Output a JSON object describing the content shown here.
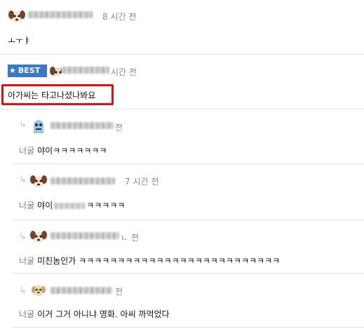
{
  "comments": [
    {
      "time": "8 시간 전",
      "text": "ㅗㅜㅑ"
    },
    {
      "badge": "BEST",
      "time": "시간 전",
      "text": "아가씨는 타고나셨나봐요"
    }
  ],
  "replies": [
    {
      "prefix": "너굴",
      "time": "전",
      "text": "야이ㅋㅋㅋㅋㅋㅋㅋ"
    },
    {
      "prefix": "너굴",
      "time": "7 시간 전",
      "text_start": "야이",
      "text_end": "ㅋㅋㅋㅋㅋ"
    },
    {
      "prefix": "너굴",
      "time": "ㄴ 전",
      "text": "미친놈인가 ㅋㅋㅋㅋㅋㅋㅋㅋㅋㅋㅋㅋㅋㅋㅋㅋㅋㅋㅋㅋㅋㅋㅋㅋㅋㅋ"
    },
    {
      "prefix": "너굴",
      "time": "전",
      "text": "이거 그거 아니냐 영화. 아씨 까먹었다"
    }
  ],
  "icons": {
    "reply": "reply-arrow-icon",
    "star": "star-icon"
  },
  "colors": {
    "best_badge": "#3a78c8",
    "highlight_border": "#e01010"
  }
}
